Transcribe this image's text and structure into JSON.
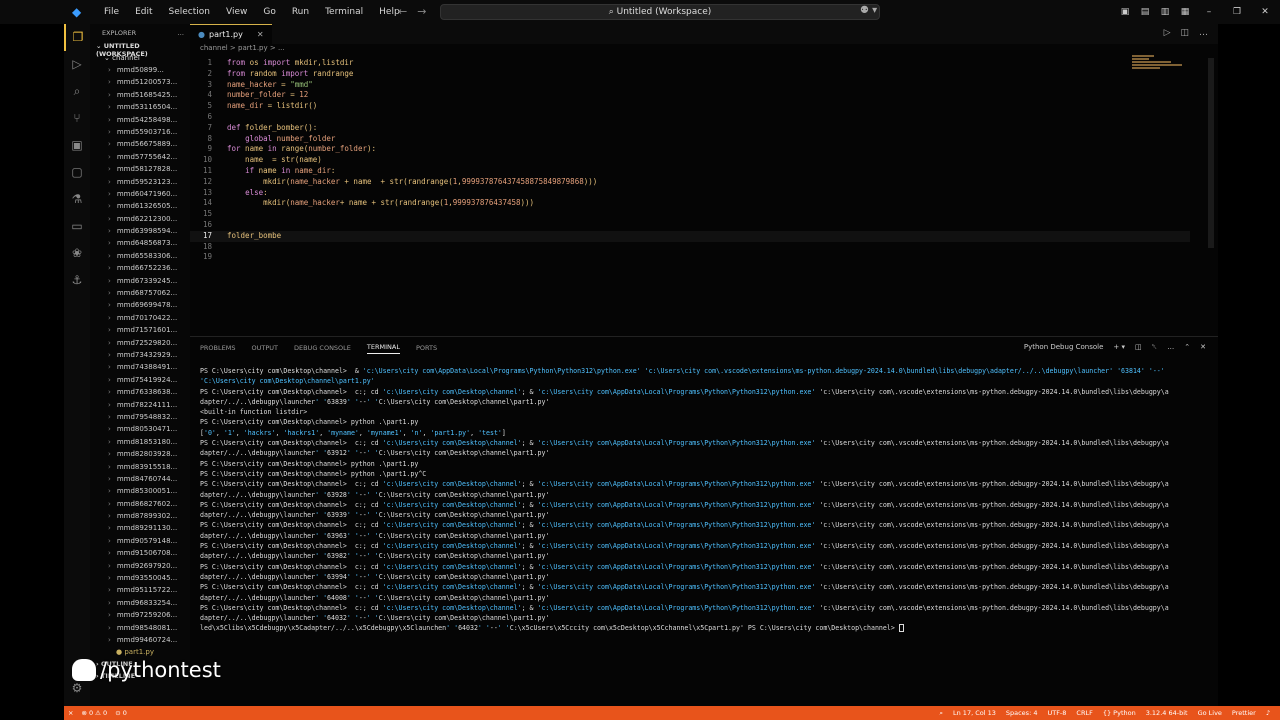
{
  "titlebar": {
    "menu": [
      "File",
      "Edit",
      "Selection",
      "View",
      "Go",
      "Run",
      "Terminal",
      "Help"
    ],
    "command_center": "Untitled (Workspace)"
  },
  "sidebar": {
    "title": "EXPLORER",
    "workspace": "UNTITLED (WORKSPACE)",
    "folder": "channel",
    "items": [
      "mmd50899...",
      "mmd51200573...",
      "mmd51685425...",
      "mmd53116504...",
      "mmd54258498...",
      "mmd55903716...",
      "mmd56675889...",
      "mmd57755642...",
      "mmd58127828...",
      "mmd59523123...",
      "mmd60471960...",
      "mmd61326505...",
      "mmd62212300...",
      "mmd63998594...",
      "mmd64856873...",
      "mmd65583306...",
      "mmd66752236...",
      "mmd67339245...",
      "mmd68757062...",
      "mmd69699478...",
      "mmd70170422...",
      "mmd71571601...",
      "mmd72529820...",
      "mmd73432929...",
      "mmd74388491...",
      "mmd75419924...",
      "mmd76338638...",
      "mmd78224111...",
      "mmd79548832...",
      "mmd80530471...",
      "mmd81853180...",
      "mmd82803928...",
      "mmd83915518...",
      "mmd84760744...",
      "mmd85300051...",
      "mmd86827602...",
      "mmd87899302...",
      "mmd89291130...",
      "mmd90579148...",
      "mmd91506708...",
      "mmd92697920...",
      "mmd93550045...",
      "mmd95115722...",
      "mmd96833254...",
      "mmd97259206...",
      "mmd98548081...",
      "mmd99460724..."
    ],
    "file": "part1.py",
    "outline": "OUTLINE",
    "timeline": "TIMELINE"
  },
  "watermark": "/pythontest",
  "editor": {
    "tab": "part1.py",
    "breadcrumb": "channel > part1.py > ...",
    "lines": [
      {
        "n": "1",
        "html": "<span class='k'>from</span> os <span class='k'>import</span> mkdir,listdir"
      },
      {
        "n": "2",
        "html": "<span class='k'>from</span> random <span class='k'>import</span> randrange"
      },
      {
        "n": "3",
        "html": "<span class='v'>name_hacker</span> = <span class='s'>\"mmd\"</span>"
      },
      {
        "n": "4",
        "html": "<span class='v'>number_folder</span> = <span class='n'>12</span>"
      },
      {
        "n": "5",
        "html": "<span class='v'>name_dir</span> = listdir()"
      },
      {
        "n": "6",
        "html": ""
      },
      {
        "n": "7",
        "html": "<span class='k'>def</span> folder_bomber():"
      },
      {
        "n": "8",
        "html": "    <span class='k'>global</span> <span class='v'>number_folder</span>"
      },
      {
        "n": "9",
        "html": "<span class='k'>for</span> name <span class='k'>in</span> range(<span class='v'>number_folder</span>):"
      },
      {
        "n": "10",
        "html": "    name  = str(name)"
      },
      {
        "n": "11",
        "html": "    <span class='k'>if</span> name <span class='k'>in</span> <span class='v'>name_dir</span>:"
      },
      {
        "n": "12",
        "html": "        mkdir(<span class='v'>name_hacker</span> + name  + str(randrange(<span class='n'>1</span>,<span class='n'>9999378764374588758498798</span><span class='n'>68</span>)))"
      },
      {
        "n": "13",
        "html": "    <span class='k'>else</span>:"
      },
      {
        "n": "14",
        "html": "        mkdir(<span class='v'>name_hacker</span>+ name + str(randrange(<span class='n'>1</span>,<span class='n'>999937876437458</span>)))"
      },
      {
        "n": "15",
        "html": ""
      },
      {
        "n": "16",
        "html": ""
      },
      {
        "n": "17",
        "html": "folder_bombe"
      },
      {
        "n": "18",
        "html": ""
      },
      {
        "n": "19",
        "html": ""
      }
    ]
  },
  "panel": {
    "tabs": [
      "PROBLEMS",
      "OUTPUT",
      "DEBUG CONSOLE",
      "TERMINAL",
      "PORTS"
    ],
    "active": "TERMINAL",
    "right_label": "Python Debug Console",
    "terminal": [
      "PS C:\\Users\\city com\\Desktop\\channel>  & 'c:\\Users\\city com\\AppData\\Local\\Programs\\Python\\Python312\\python.exe' 'c:\\Users\\city com\\.vscode\\extensions\\ms-python.debugpy-2024.14.0\\bundled\\libs\\debugpy\\adapter/../..\\debugpy\\launcher' '63814' '--'",
      "'C:\\Users\\city com\\Desktop\\channel\\part1.py'",
      "PS C:\\Users\\city com\\Desktop\\channel>  c:; cd 'c:\\Users\\city com\\Desktop\\channel'; & 'c:\\Users\\city com\\AppData\\Local\\Programs\\Python\\Python312\\python.exe' 'c:\\Users\\city com\\.vscode\\extensions\\ms-python.debugpy-2024.14.0\\bundled\\libs\\debugpy\\a",
      "dapter/../..\\debugpy\\launcher' '63839' '--' 'C:\\Users\\city com\\Desktop\\channel\\part1.py'",
      "<built-in function listdir>",
      "PS C:\\Users\\city com\\Desktop\\channel> python .\\part1.py",
      "['0', '1', 'hackrs', 'hackrs1', 'myname', 'myname1', 'n', 'part1.py', 'test']",
      "PS C:\\Users\\city com\\Desktop\\channel>  c:; cd 'c:\\Users\\city com\\Desktop\\channel'; & 'c:\\Users\\city com\\AppData\\Local\\Programs\\Python\\Python312\\python.exe' 'c:\\Users\\city com\\.vscode\\extensions\\ms-python.debugpy-2024.14.0\\bundled\\libs\\debugpy\\a",
      "dapter/../..\\debugpy\\launcher' '63912' '--' 'C:\\Users\\city com\\Desktop\\channel\\part1.py'",
      "PS C:\\Users\\city com\\Desktop\\channel> python .\\part1.py",
      "PS C:\\Users\\city com\\Desktop\\channel> python .\\part1.py^C",
      "PS C:\\Users\\city com\\Desktop\\channel>  c:; cd 'c:\\Users\\city com\\Desktop\\channel'; & 'c:\\Users\\city com\\AppData\\Local\\Programs\\Python\\Python312\\python.exe' 'c:\\Users\\city com\\.vscode\\extensions\\ms-python.debugpy-2024.14.0\\bundled\\libs\\debugpy\\a",
      "dapter/../..\\debugpy\\launcher' '63928' '--' 'C:\\Users\\city com\\Desktop\\channel\\part1.py'",
      "PS C:\\Users\\city com\\Desktop\\channel>  c:; cd 'c:\\Users\\city com\\Desktop\\channel'; & 'c:\\Users\\city com\\AppData\\Local\\Programs\\Python\\Python312\\python.exe' 'c:\\Users\\city com\\.vscode\\extensions\\ms-python.debugpy-2024.14.0\\bundled\\libs\\debugpy\\a",
      "dapter/../..\\debugpy\\launcher' '63939' '--' 'C:\\Users\\city com\\Desktop\\channel\\part1.py'",
      "PS C:\\Users\\city com\\Desktop\\channel>  c:; cd 'c:\\Users\\city com\\Desktop\\channel'; & 'c:\\Users\\city com\\AppData\\Local\\Programs\\Python\\Python312\\python.exe' 'c:\\Users\\city com\\.vscode\\extensions\\ms-python.debugpy-2024.14.0\\bundled\\libs\\debugpy\\a",
      "dapter/../..\\debugpy\\launcher' '63963' '--' 'C:\\Users\\city com\\Desktop\\channel\\part1.py'",
      "PS C:\\Users\\city com\\Desktop\\channel>  c:; cd 'c:\\Users\\city com\\Desktop\\channel'; & 'c:\\Users\\city com\\AppData\\Local\\Programs\\Python\\Python312\\python.exe' 'c:\\Users\\city com\\.vscode\\extensions\\ms-python.debugpy-2024.14.0\\bundled\\libs\\debugpy\\a",
      "dapter/../..\\debugpy\\launcher' '63982' '--' 'C:\\Users\\city com\\Desktop\\channel\\part1.py'",
      "PS C:\\Users\\city com\\Desktop\\channel>  c:; cd 'c:\\Users\\city com\\Desktop\\channel'; & 'c:\\Users\\city com\\AppData\\Local\\Programs\\Python\\Python312\\python.exe' 'c:\\Users\\city com\\.vscode\\extensions\\ms-python.debugpy-2024.14.0\\bundled\\libs\\debugpy\\a",
      "dapter/../..\\debugpy\\launcher' '63994' '--' 'C:\\Users\\city com\\Desktop\\channel\\part1.py'",
      "PS C:\\Users\\city com\\Desktop\\channel>  c:; cd 'c:\\Users\\city com\\Desktop\\channel'; & 'c:\\Users\\city com\\AppData\\Local\\Programs\\Python\\Python312\\python.exe' 'c:\\Users\\city com\\.vscode\\extensions\\ms-python.debugpy-2024.14.0\\bundled\\libs\\debugpy\\a",
      "dapter/../..\\debugpy\\launcher' '64008' '--' 'C:\\Users\\city com\\Desktop\\channel\\part1.py'",
      "PS C:\\Users\\city com\\Desktop\\channel>  c:; cd 'c:\\Users\\city com\\Desktop\\channel'; & 'c:\\Users\\city com\\AppData\\Local\\Programs\\Python\\Python312\\python.exe' 'c:\\Users\\city com\\.vscode\\extensions\\ms-python.debugpy-2024.14.0\\bundled\\libs\\debugpy\\a",
      "dapter/../..\\debugpy\\launcher' '64032' '--' 'C:\\Users\\city com\\Desktop\\channel\\part1.py'",
      "led\\x5Clibs\\x5Cdebugpy\\x5Cadapter/../..\\x5Cdebugpy\\x5Claunchen' '64032' '--' 'C:\\x5cUsers\\x5Cccity com\\x5cDesktop\\x5Cchannel\\x5Cpart1.py' PS C:\\Users\\city com\\Desktop\\channel> "
    ]
  },
  "statusbar": {
    "left": [
      "⊗ 0 ⚠ 0",
      "⊙ 0"
    ],
    "right": [
      "Ln 17, Col 13",
      "Spaces: 4",
      "UTF-8",
      "CRLF",
      "{} Python",
      "3.12.4 64-bit",
      "Go Live",
      "Prettier"
    ]
  }
}
